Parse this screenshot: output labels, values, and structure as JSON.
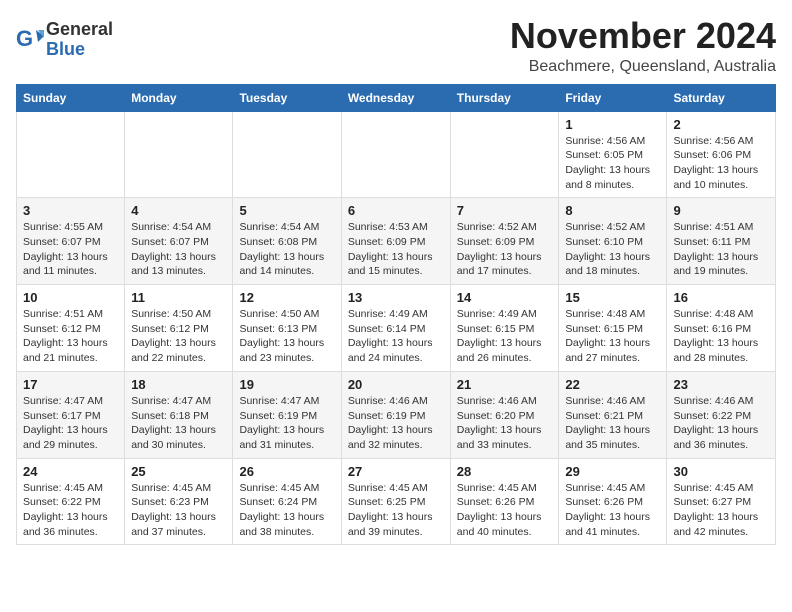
{
  "header": {
    "logo_general": "General",
    "logo_blue": "Blue",
    "month_title": "November 2024",
    "location": "Beachmere, Queensland, Australia"
  },
  "days_of_week": [
    "Sunday",
    "Monday",
    "Tuesday",
    "Wednesday",
    "Thursday",
    "Friday",
    "Saturday"
  ],
  "weeks": [
    [
      {
        "day": "",
        "info": ""
      },
      {
        "day": "",
        "info": ""
      },
      {
        "day": "",
        "info": ""
      },
      {
        "day": "",
        "info": ""
      },
      {
        "day": "",
        "info": ""
      },
      {
        "day": "1",
        "info": "Sunrise: 4:56 AM\nSunset: 6:05 PM\nDaylight: 13 hours and 8 minutes."
      },
      {
        "day": "2",
        "info": "Sunrise: 4:56 AM\nSunset: 6:06 PM\nDaylight: 13 hours and 10 minutes."
      }
    ],
    [
      {
        "day": "3",
        "info": "Sunrise: 4:55 AM\nSunset: 6:07 PM\nDaylight: 13 hours and 11 minutes."
      },
      {
        "day": "4",
        "info": "Sunrise: 4:54 AM\nSunset: 6:07 PM\nDaylight: 13 hours and 13 minutes."
      },
      {
        "day": "5",
        "info": "Sunrise: 4:54 AM\nSunset: 6:08 PM\nDaylight: 13 hours and 14 minutes."
      },
      {
        "day": "6",
        "info": "Sunrise: 4:53 AM\nSunset: 6:09 PM\nDaylight: 13 hours and 15 minutes."
      },
      {
        "day": "7",
        "info": "Sunrise: 4:52 AM\nSunset: 6:09 PM\nDaylight: 13 hours and 17 minutes."
      },
      {
        "day": "8",
        "info": "Sunrise: 4:52 AM\nSunset: 6:10 PM\nDaylight: 13 hours and 18 minutes."
      },
      {
        "day": "9",
        "info": "Sunrise: 4:51 AM\nSunset: 6:11 PM\nDaylight: 13 hours and 19 minutes."
      }
    ],
    [
      {
        "day": "10",
        "info": "Sunrise: 4:51 AM\nSunset: 6:12 PM\nDaylight: 13 hours and 21 minutes."
      },
      {
        "day": "11",
        "info": "Sunrise: 4:50 AM\nSunset: 6:12 PM\nDaylight: 13 hours and 22 minutes."
      },
      {
        "day": "12",
        "info": "Sunrise: 4:50 AM\nSunset: 6:13 PM\nDaylight: 13 hours and 23 minutes."
      },
      {
        "day": "13",
        "info": "Sunrise: 4:49 AM\nSunset: 6:14 PM\nDaylight: 13 hours and 24 minutes."
      },
      {
        "day": "14",
        "info": "Sunrise: 4:49 AM\nSunset: 6:15 PM\nDaylight: 13 hours and 26 minutes."
      },
      {
        "day": "15",
        "info": "Sunrise: 4:48 AM\nSunset: 6:15 PM\nDaylight: 13 hours and 27 minutes."
      },
      {
        "day": "16",
        "info": "Sunrise: 4:48 AM\nSunset: 6:16 PM\nDaylight: 13 hours and 28 minutes."
      }
    ],
    [
      {
        "day": "17",
        "info": "Sunrise: 4:47 AM\nSunset: 6:17 PM\nDaylight: 13 hours and 29 minutes."
      },
      {
        "day": "18",
        "info": "Sunrise: 4:47 AM\nSunset: 6:18 PM\nDaylight: 13 hours and 30 minutes."
      },
      {
        "day": "19",
        "info": "Sunrise: 4:47 AM\nSunset: 6:19 PM\nDaylight: 13 hours and 31 minutes."
      },
      {
        "day": "20",
        "info": "Sunrise: 4:46 AM\nSunset: 6:19 PM\nDaylight: 13 hours and 32 minutes."
      },
      {
        "day": "21",
        "info": "Sunrise: 4:46 AM\nSunset: 6:20 PM\nDaylight: 13 hours and 33 minutes."
      },
      {
        "day": "22",
        "info": "Sunrise: 4:46 AM\nSunset: 6:21 PM\nDaylight: 13 hours and 35 minutes."
      },
      {
        "day": "23",
        "info": "Sunrise: 4:46 AM\nSunset: 6:22 PM\nDaylight: 13 hours and 36 minutes."
      }
    ],
    [
      {
        "day": "24",
        "info": "Sunrise: 4:45 AM\nSunset: 6:22 PM\nDaylight: 13 hours and 36 minutes."
      },
      {
        "day": "25",
        "info": "Sunrise: 4:45 AM\nSunset: 6:23 PM\nDaylight: 13 hours and 37 minutes."
      },
      {
        "day": "26",
        "info": "Sunrise: 4:45 AM\nSunset: 6:24 PM\nDaylight: 13 hours and 38 minutes."
      },
      {
        "day": "27",
        "info": "Sunrise: 4:45 AM\nSunset: 6:25 PM\nDaylight: 13 hours and 39 minutes."
      },
      {
        "day": "28",
        "info": "Sunrise: 4:45 AM\nSunset: 6:26 PM\nDaylight: 13 hours and 40 minutes."
      },
      {
        "day": "29",
        "info": "Sunrise: 4:45 AM\nSunset: 6:26 PM\nDaylight: 13 hours and 41 minutes."
      },
      {
        "day": "30",
        "info": "Sunrise: 4:45 AM\nSunset: 6:27 PM\nDaylight: 13 hours and 42 minutes."
      }
    ]
  ]
}
